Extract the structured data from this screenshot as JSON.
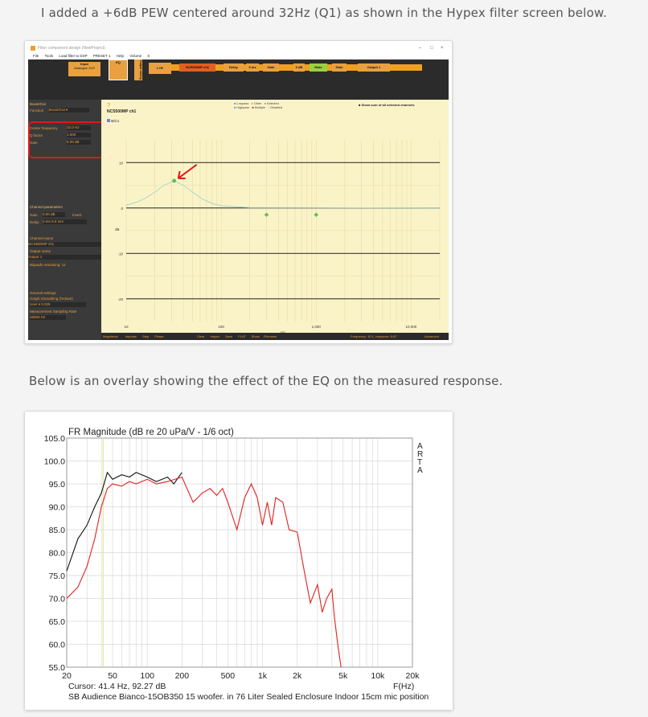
{
  "post": {
    "para1": "I added a +6dB PEW centered around 32Hz (Q1) as shown in the Hypex filter screen below.",
    "para2": "Below is an overlay showing the effect of the EQ on the measured response."
  },
  "hypex": {
    "window_title": "Filter component design (NewProject)",
    "menu": [
      "File",
      "Tools",
      "Load filter to DSP",
      "PRESET 1",
      "Help",
      "Volume",
      "0"
    ],
    "blocks": {
      "input_label": "Input",
      "input_sub": "Analogue XLR",
      "eq_label": "EQ",
      "output_mixing_label": "Output mixing",
      "lr_label": "L+R",
      "chain": [
        "NCS500MP ch1",
        "Delay",
        "0 ms",
        "Gain",
        "0 dB",
        "Mute",
        "Gain",
        "Output 1"
      ]
    },
    "sidebar": {
      "filter_name": "Boost/Cut",
      "function_label": "Function",
      "function_value": "Boost/Cut",
      "center_freq_label": "Center frequency",
      "center_freq_value": "32.0",
      "center_freq_unit": "Hz",
      "q_label": "Q factor",
      "q_value": "1.000",
      "gain_label": "Gain",
      "gain_value": "6.00",
      "gain_unit": "dB",
      "channel_params": "Channel parameters",
      "ch_gain_label": "Gain",
      "ch_gain_value": "0.00",
      "ch_gain_unit": "dB",
      "invert": "Invert",
      "delay_label": "Delay",
      "delay_value": "0",
      "delay_unit": "ms",
      "delay_mm": "0.0",
      "delay_mm_unit": "mm",
      "channel_name_label": "Channel name",
      "channel_name_value": "NCS500MP ch1",
      "output_name_label": "Output name",
      "output_name_value": "Output 1",
      "biquads": "Biquads remaining: 11",
      "general_settings": "General settings",
      "graph_smoothing": "Graph Smoothing (Octave)",
      "user_label": "User",
      "smoothing_value": "0.025",
      "sampling_rate_label": "Measurement Sampling Rate",
      "sampling_rate_value": "48000",
      "sampling_rate_unit": "Hz"
    },
    "plot": {
      "title": "NCS500MP ch1",
      "legend_bc": "B/C1",
      "legend_items": [
        "Lowpass",
        "Highpass",
        "Other",
        "Multiple",
        "Selected",
        "Disabled"
      ],
      "show_sum": "Show sum of all selected channels",
      "ylabel": "dB",
      "xlabel": "Hz",
      "yticks": [
        "10",
        "0",
        "-10",
        "-20"
      ],
      "xticks": [
        "10",
        "100",
        "1,000",
        "10,000"
      ]
    },
    "status": {
      "tabs": [
        "Magnitude",
        "Impulse",
        "Step",
        "Phase"
      ],
      "buttons": [
        "Clear",
        "Import",
        "Save",
        "FLAT",
        "Show",
        "Filename"
      ],
      "frequency": "Frequency: 30.1, response: 5.87",
      "advanced": "Advanced"
    }
  },
  "arta": {
    "title": "FR Magnitude (dB re 20 uPa/V - 1/6 oct)",
    "brand": [
      "A",
      "R",
      "T",
      "A"
    ],
    "yticks": [
      "105.0",
      "100.0",
      "95.0",
      "90.0",
      "85.0",
      "80.0",
      "75.0",
      "70.0",
      "65.0",
      "60.0",
      "55.0"
    ],
    "xticks": [
      "20",
      "50",
      "100",
      "200",
      "500",
      "1k",
      "2k",
      "5k",
      "10k",
      "20k"
    ],
    "cursor": "Cursor: 41.4 Hz, 92.27 dB",
    "xunit": "F(Hz)",
    "footer": "SB Audience Bianco-15OB350 15 woofer. in 76 Liter Sealed Enclosure Indoor 15cm mic position",
    "colors": {
      "black_trace": "#111111",
      "red_trace": "#e02020",
      "cursor_line": "#e6e6a0"
    }
  },
  "chart_data": {
    "type": "line",
    "title": "FR Magnitude (dB re 20 uPa/V - 1/6 oct)",
    "xlabel": "F(Hz)",
    "ylabel": "",
    "xscale": "log",
    "xlim": [
      20,
      20000
    ],
    "ylim": [
      55,
      105
    ],
    "series": [
      {
        "color": "#111111",
        "x": [
          20,
          25,
          30,
          35,
          40,
          45,
          50,
          60,
          70,
          80,
          100,
          120,
          150,
          170,
          200
        ],
        "y": [
          76,
          83,
          86,
          90,
          93,
          97.5,
          96,
          97,
          96.5,
          97.5,
          96.5,
          95.5,
          96.5,
          95,
          97.5
        ]
      },
      {
        "color": "#e02020",
        "x": [
          20,
          25,
          30,
          35,
          40,
          45,
          50,
          60,
          70,
          80,
          100,
          120,
          150,
          200,
          250,
          300,
          350,
          400,
          450,
          500,
          600,
          700,
          800,
          900,
          1000,
          1100,
          1200,
          1300,
          1500,
          1700,
          2000,
          2300,
          2600,
          3000,
          3300,
          3600,
          4000,
          4200,
          4500,
          4800
        ],
        "y": [
          70,
          72.5,
          77,
          83,
          90,
          94,
          95,
          94.5,
          95.5,
          95,
          96,
          95,
          95.5,
          96.5,
          91,
          93,
          94,
          92.5,
          94,
          91,
          85,
          92,
          95,
          92,
          86,
          91,
          86,
          92,
          91,
          85,
          84.5,
          76,
          69,
          73,
          67,
          70,
          72,
          66,
          60,
          55
        ]
      }
    ]
  },
  "hypex_chart": {
    "type": "line",
    "xscale": "log",
    "xlim": [
      10,
      20000
    ],
    "ylim": [
      -25,
      15
    ],
    "series": [
      {
        "color": "#a8d8c8",
        "x": [
          10,
          13,
          16,
          20,
          25,
          32,
          40,
          50,
          63,
          80,
          100,
          200
        ],
        "y": [
          0.6,
          1.3,
          2.2,
          3.5,
          5.0,
          6.0,
          5.0,
          3.5,
          2.0,
          1.0,
          0.5,
          0.1
        ]
      }
    ],
    "marker": {
      "x": 32,
      "y": 6
    }
  }
}
